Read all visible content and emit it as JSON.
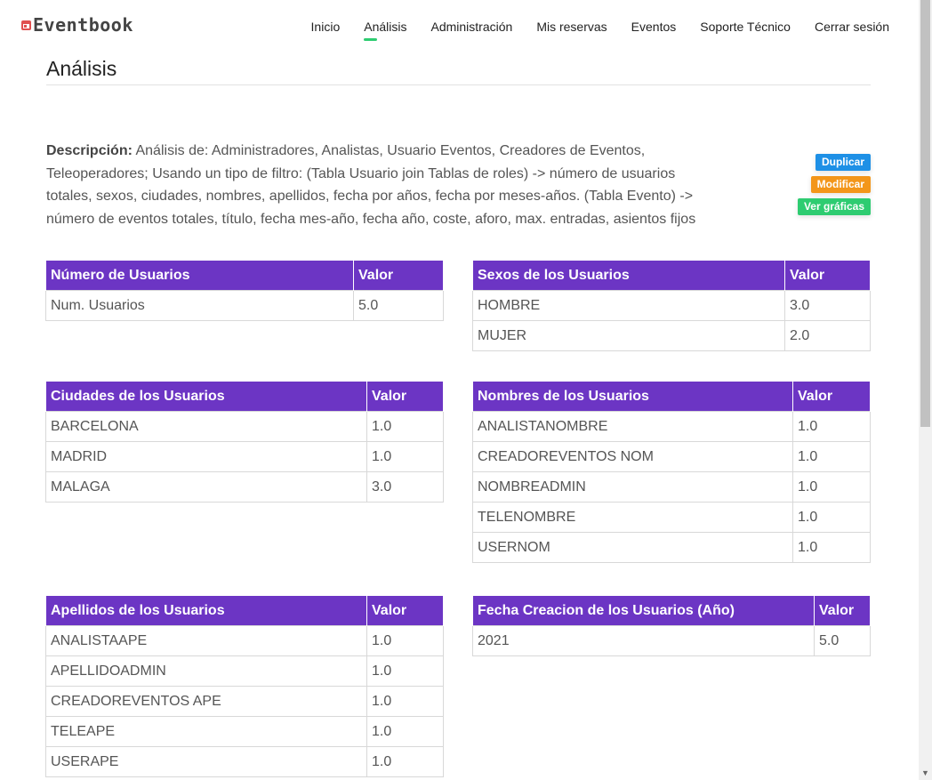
{
  "brand": {
    "name": "Eventbook"
  },
  "nav": [
    {
      "label": "Inicio"
    },
    {
      "label": "Análisis"
    },
    {
      "label": "Administración"
    },
    {
      "label": "Mis reservas"
    },
    {
      "label": "Eventos"
    },
    {
      "label": "Soporte Técnico"
    },
    {
      "label": "Cerrar sesión"
    }
  ],
  "page": {
    "title": "Análisis"
  },
  "description": {
    "label": "Descripción:",
    "text": " Análisis de: Administradores, Analistas, Usuario Eventos, Creadores de Eventos, Teleoperadores; Usando un tipo de filtro: (Tabla Usuario join Tablas de roles) -> número de usuarios totales, sexos, ciudades, nombres, apellidos, fecha por años, fecha por meses-años. (Tabla Evento) -> número de eventos totales, título, fecha mes-año, fecha año, coste, aforo, max. entradas, asientos fijos"
  },
  "actions": {
    "duplicate": "Duplicar",
    "modify": "Modificar",
    "charts": "Ver gráficas"
  },
  "tables": {
    "num_users": {
      "header": "Número de Usuarios",
      "value_header": "Valor",
      "rows": [
        {
          "k": "Num. Usuarios",
          "v": "5.0"
        }
      ]
    },
    "sexes": {
      "header": "Sexos de los Usuarios",
      "value_header": "Valor",
      "rows": [
        {
          "k": "HOMBRE",
          "v": "3.0"
        },
        {
          "k": "MUJER",
          "v": "2.0"
        }
      ]
    },
    "cities": {
      "header": "Ciudades de los Usuarios",
      "value_header": "Valor",
      "rows": [
        {
          "k": "BARCELONA",
          "v": "1.0"
        },
        {
          "k": "MADRID",
          "v": "1.0"
        },
        {
          "k": "MALAGA",
          "v": "3.0"
        }
      ]
    },
    "names": {
      "header": "Nombres de los Usuarios",
      "value_header": "Valor",
      "rows": [
        {
          "k": "ANALISTANOMBRE",
          "v": "1.0"
        },
        {
          "k": "CREADOREVENTOS NOM",
          "v": "1.0"
        },
        {
          "k": "NOMBREADMIN",
          "v": "1.0"
        },
        {
          "k": "TELENOMBRE",
          "v": "1.0"
        },
        {
          "k": "USERNOM",
          "v": "1.0"
        }
      ]
    },
    "surnames": {
      "header": "Apellidos de los Usuarios",
      "value_header": "Valor",
      "rows": [
        {
          "k": "ANALISTAAPE",
          "v": "1.0"
        },
        {
          "k": "APELLIDOADMIN",
          "v": "1.0"
        },
        {
          "k": "CREADOREVENTOS APE",
          "v": "1.0"
        },
        {
          "k": "TELEAPE",
          "v": "1.0"
        },
        {
          "k": "USERAPE",
          "v": "1.0"
        }
      ]
    },
    "creation_year": {
      "header": "Fecha Creacion de los Usuarios (Año)",
      "value_header": "Valor",
      "rows": [
        {
          "k": "2021",
          "v": "5.0"
        }
      ]
    }
  },
  "colors": {
    "table_header": "#6c35c4",
    "active_underline": "#2ecc71",
    "duplicate": "#1e90e6",
    "modify": "#f3961a",
    "charts": "#2ecc71"
  }
}
